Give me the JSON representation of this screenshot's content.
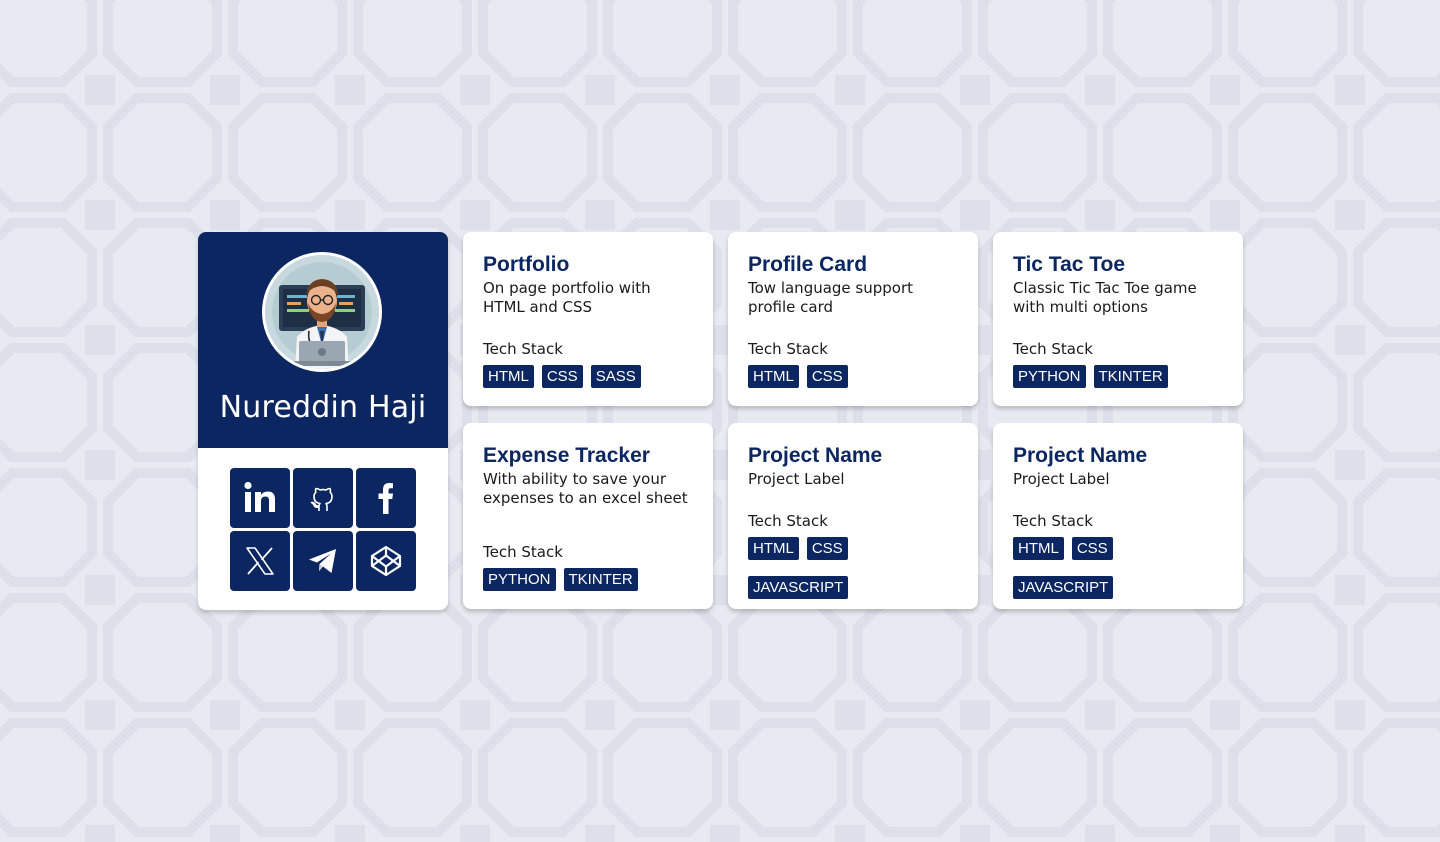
{
  "profile": {
    "name": "Nureddin Haji",
    "social": [
      {
        "icon": "linkedin-icon"
      },
      {
        "icon": "github-icon"
      },
      {
        "icon": "facebook-icon"
      },
      {
        "icon": "x-icon"
      },
      {
        "icon": "telegram-icon"
      },
      {
        "icon": "codepen-icon"
      }
    ]
  },
  "projects": [
    {
      "title": "Portfolio",
      "description": "On page portfolio with HTML and CSS",
      "tech_label": "Tech Stack",
      "tags": [
        "HTML",
        "CSS",
        "SASS"
      ]
    },
    {
      "title": "Profile Card",
      "description": "Tow language support profile card",
      "tech_label": "Tech Stack",
      "tags": [
        "HTML",
        "CSS"
      ]
    },
    {
      "title": "Tic Tac Toe",
      "description": "Classic Tic Tac Toe game with multi options",
      "tech_label": "Tech Stack",
      "tags": [
        "PYTHON",
        "TKINTER"
      ]
    },
    {
      "title": "Expense Tracker",
      "description": "With ability to save your expenses to an excel sheet",
      "tech_label": "Tech Stack",
      "tags": [
        "PYTHON",
        "TKINTER"
      ]
    },
    {
      "title": "Project Name",
      "description": "Project Label",
      "tech_label": "Tech Stack",
      "tags": [
        "HTML",
        "CSS",
        "JAVASCRIPT"
      ]
    },
    {
      "title": "Project Name",
      "description": "Project Label",
      "tech_label": "Tech Stack",
      "tags": [
        "HTML",
        "CSS",
        "JAVASCRIPT"
      ]
    }
  ],
  "colors": {
    "brand": "#0b2660",
    "background": "#e8eaf1",
    "card": "#ffffff"
  }
}
